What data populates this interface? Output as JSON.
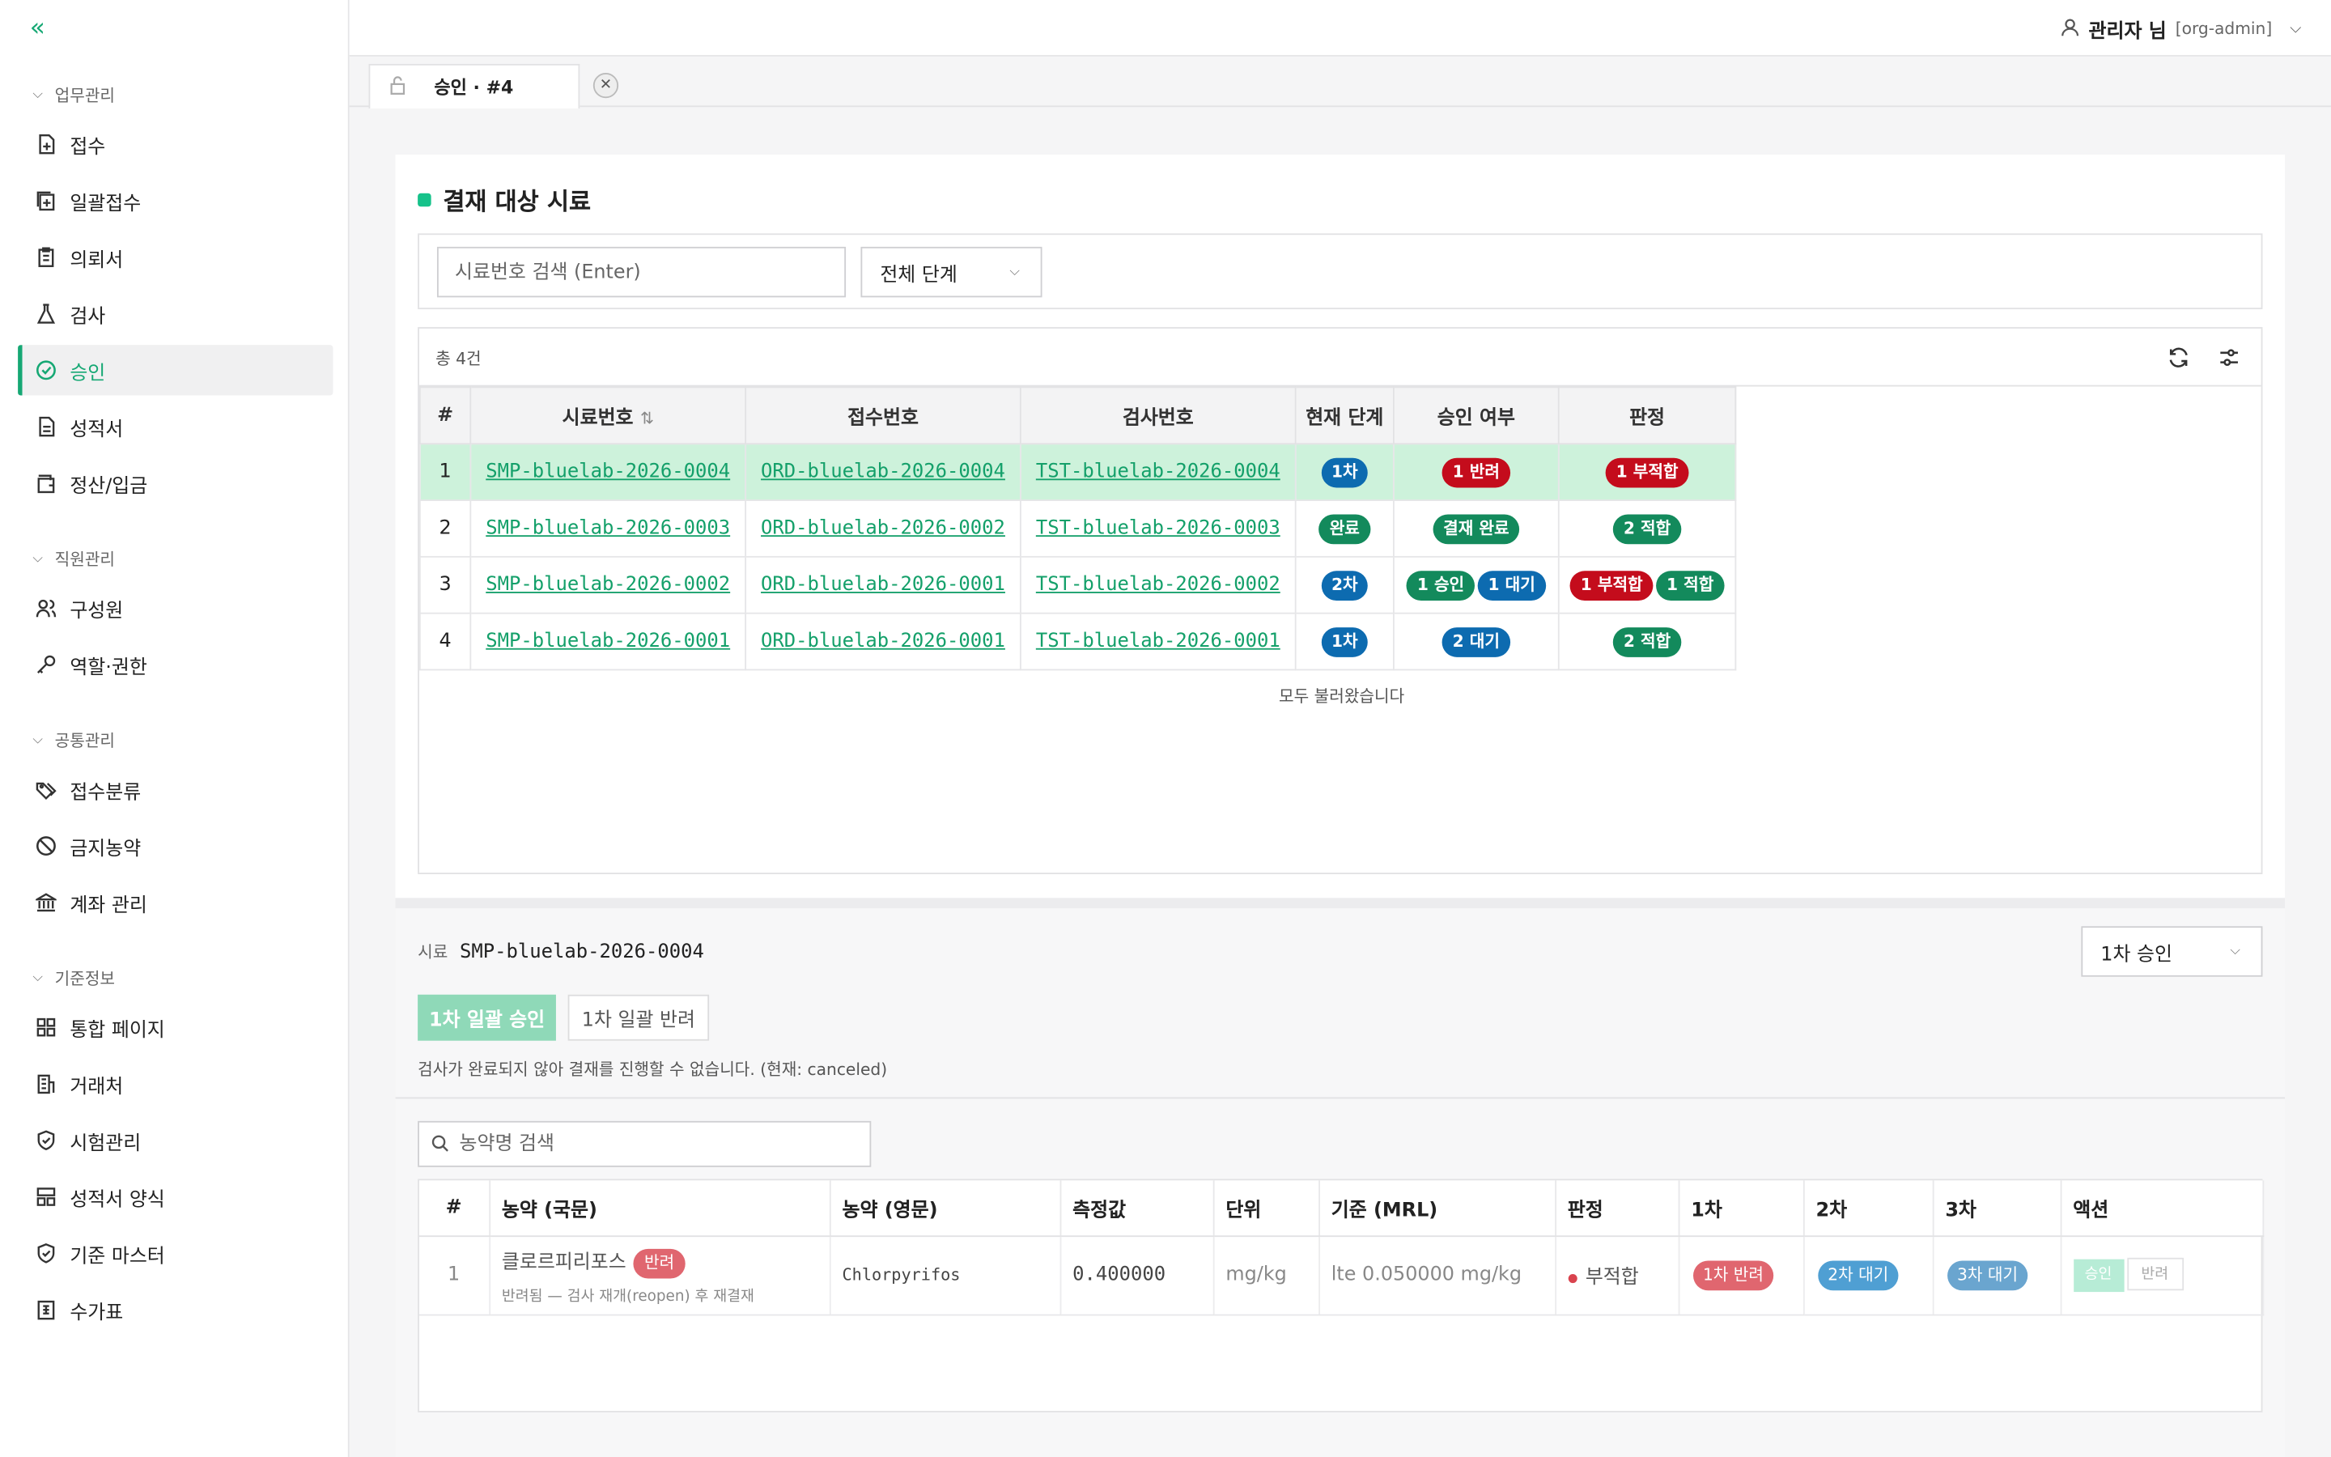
{
  "sidebar": {
    "groups": [
      {
        "title": "업무관리",
        "items": [
          "접수",
          "일괄접수",
          "의뢰서",
          "검사",
          "승인",
          "성적서",
          "정산/입금"
        ]
      },
      {
        "title": "직원관리",
        "items": [
          "구성원",
          "역할·권한"
        ]
      },
      {
        "title": "공통관리",
        "items": [
          "접수분류",
          "금지농약",
          "계좌 관리"
        ]
      },
      {
        "title": "기준정보",
        "items": [
          "통합 페이지",
          "거래처",
          "시험관리",
          "성적서 양식",
          "기준 마스터",
          "수가표"
        ]
      }
    ],
    "active": "승인"
  },
  "header": {
    "user_name": "관리자 님",
    "user_role": "[org-admin]"
  },
  "tab": {
    "label": "승인 · #4"
  },
  "list": {
    "title": "결재 대상 시료",
    "search_placeholder": "시료번호 검색 (Enter)",
    "stage_filter": "전체 단계",
    "count": "총 4건",
    "columns": [
      "#",
      "시료번호",
      "접수번호",
      "검사번호",
      "현재 단계",
      "승인 여부",
      "판정"
    ],
    "rows": [
      {
        "no": "1",
        "sample": "SMP-bluelab-2026-0004",
        "order": "ORD-bluelab-2026-0004",
        "test": "TST-bluelab-2026-0004",
        "stage": "1차",
        "approval": [
          "1 반려"
        ],
        "verdict": [
          "1 부적합"
        ]
      },
      {
        "no": "2",
        "sample": "SMP-bluelab-2026-0003",
        "order": "ORD-bluelab-2026-0002",
        "test": "TST-bluelab-2026-0003",
        "stage": "완료",
        "approval": [
          "결재 완료"
        ],
        "verdict": [
          "2 적합"
        ]
      },
      {
        "no": "3",
        "sample": "SMP-bluelab-2026-0002",
        "order": "ORD-bluelab-2026-0001",
        "test": "TST-bluelab-2026-0002",
        "stage": "2차",
        "approval": [
          "1 승인",
          "1 대기"
        ],
        "verdict": [
          "1 부적합",
          "1 적합"
        ]
      },
      {
        "no": "4",
        "sample": "SMP-bluelab-2026-0001",
        "order": "ORD-bluelab-2026-0001",
        "test": "TST-bluelab-2026-0001",
        "stage": "1차",
        "approval": [
          "2 대기"
        ],
        "verdict": [
          "2 적합"
        ]
      }
    ],
    "loaded_text": "모두 불러왔습니다"
  },
  "detail": {
    "sample_label": "시료",
    "sample_code": "SMP-bluelab-2026-0004",
    "stage_select": "1차 승인",
    "approve_btn": "1차 일괄 승인",
    "reject_btn": "1차 일괄 반려",
    "warning": "검사가 완료되지 않아 결재를 진행할 수 없습니다. (현재: canceled)",
    "pest_search_placeholder": "농약명 검색",
    "columns": [
      "#",
      "농약 (국문)",
      "농약 (영문)",
      "측정값",
      "단위",
      "기준 (MRL)",
      "판정",
      "1차",
      "2차",
      "3차",
      "액션"
    ],
    "rows": [
      {
        "no": "1",
        "name_ko": "클로르피리포스",
        "name_badge": "반려",
        "sub": "반려됨 — 검사 재개(reopen) 후 재결재",
        "name_en": "Chlorpyrifos",
        "value": "0.400000",
        "unit": "mg/kg",
        "mrl": "lte 0.050000 mg/kg",
        "verdict": "부적합",
        "s1": "1차 반려",
        "s2": "2차 대기",
        "s3": "3차 대기",
        "act_approve": "승인",
        "act_reject": "반려"
      }
    ]
  },
  "colors": {
    "accent": "#16a874",
    "selected_row": "#cdf2db",
    "badge_blue": "#0d6bb0",
    "badge_green": "#138a5c",
    "badge_red": "#c40c1c"
  }
}
